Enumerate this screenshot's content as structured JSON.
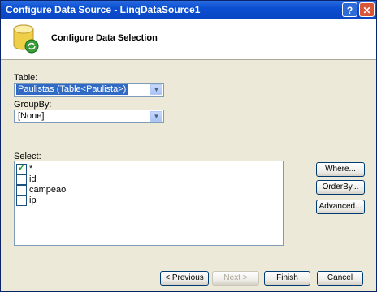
{
  "window": {
    "title": "Configure Data Source - LinqDataSource1"
  },
  "header": {
    "title": "Configure Data Selection"
  },
  "table": {
    "label": "Table:",
    "selected": "Paulistas (Table<Paulista>)"
  },
  "groupby": {
    "label": "GroupBy:",
    "selected": "[None]"
  },
  "select": {
    "label": "Select:",
    "items": [
      {
        "label": "*",
        "checked": true
      },
      {
        "label": "id",
        "checked": false
      },
      {
        "label": "campeao",
        "checked": false
      },
      {
        "label": "ip",
        "checked": false
      }
    ]
  },
  "side_buttons": {
    "where": "Where...",
    "orderby": "OrderBy...",
    "advanced": "Advanced..."
  },
  "footer": {
    "previous": "< Previous",
    "next": "Next >",
    "finish": "Finish",
    "cancel": "Cancel"
  },
  "colors": {
    "titlebar": "#0a46c4",
    "selection": "#316ac5",
    "dialog": "#ece9d8"
  }
}
